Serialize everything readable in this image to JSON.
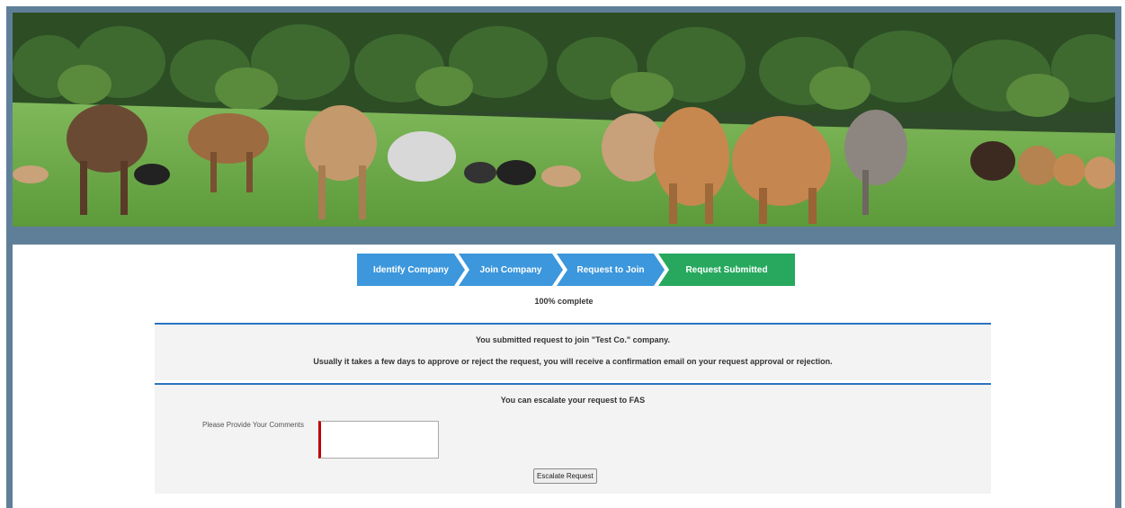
{
  "steps": [
    {
      "label": "Identify Company",
      "state": "complete",
      "color": "#3c97dc"
    },
    {
      "label": "Join Company",
      "state": "complete",
      "color": "#3c97dc"
    },
    {
      "label": "Request to Join",
      "state": "complete",
      "color": "#3c97dc"
    },
    {
      "label": "Request Submitted",
      "state": "current",
      "color": "#27a85e"
    }
  ],
  "progress": {
    "text": "100% complete",
    "value": 100
  },
  "confirmation": {
    "line1": "You submitted  request to join \"Test Co.\" company.",
    "line2": "Usually it takes a few days to approve or reject the request, you will receive a confirmation email on your request approval or rejection."
  },
  "escalation": {
    "heading": "You can escalate your request to FAS",
    "comments_label": "Please Provide Your Comments",
    "comments_value": "",
    "button_label": "Escalate Request"
  },
  "banner": {
    "image": "cows-in-pasture"
  },
  "colors": {
    "frame": "#5f7f98",
    "accent_blue": "#2c73c0",
    "step_blue": "#3c97dc",
    "step_green": "#27a85e",
    "required": "#c00000"
  }
}
